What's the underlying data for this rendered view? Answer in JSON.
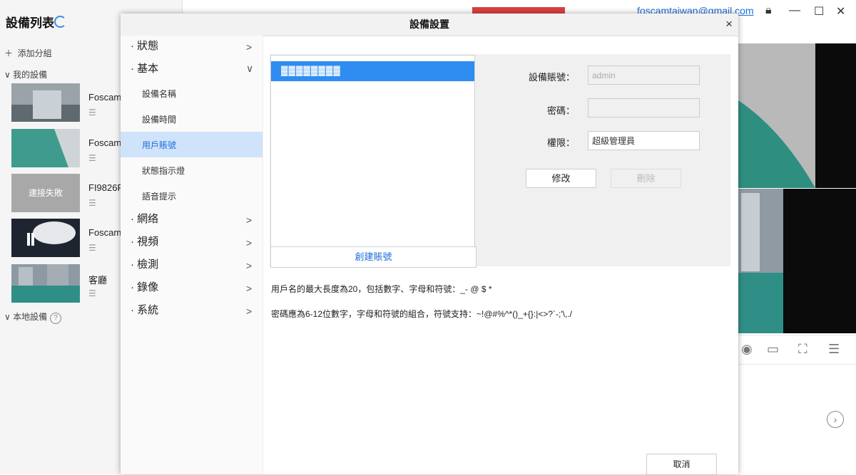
{
  "app": {
    "device_list_title": "設備列表",
    "add_group": "添加分組",
    "my_devices": "我的設備",
    "local_devices": "本地設備",
    "help_mark": "?",
    "email": "foscamtaiwan@gmail.com",
    "devices": [
      {
        "name": "Foscam_",
        "status": ""
      },
      {
        "name": "Foscam_",
        "status": ""
      },
      {
        "name": "FI9826P",
        "status": "連接失敗"
      },
      {
        "name": "Foscam_",
        "status": ""
      },
      {
        "name": "客廳",
        "status": ""
      }
    ]
  },
  "dialog": {
    "title": "設備設置",
    "close": "×",
    "menu": [
      {
        "label": "狀態",
        "expanded": false
      },
      {
        "label": "基本",
        "expanded": true
      },
      {
        "label": "網络",
        "expanded": false
      },
      {
        "label": "視頻",
        "expanded": false
      },
      {
        "label": "檢測",
        "expanded": false
      },
      {
        "label": "錄像",
        "expanded": false
      },
      {
        "label": "系統",
        "expanded": false
      }
    ],
    "submenu": [
      "設備名稱",
      "設備時間",
      "用戶賬號",
      "狀態指示燈",
      "語音提示"
    ],
    "active_submenu": "用戶賬號",
    "account_list": {
      "selected_row": "▓▓▓▓▓▓▓▓"
    },
    "create_account": "創建賬號",
    "form": {
      "account_label": "設備賬號：",
      "account_value": "admin",
      "password_label": "密碼：",
      "password_value": "",
      "permission_label": "權限：",
      "permission_value": "超級管理員",
      "modify": "修改",
      "delete": "刪除"
    },
    "notes": [
      "用戶名的最大長度為20，包括數字、字母和符號：_- @ $ *",
      "密碼應為6-12位數字，字母和符號的組合，符號支持：~!@#%^*()_+{}:|<>?`-;'\\,./"
    ],
    "cancel": "取消"
  },
  "colors": {
    "accent": "#1e6fd9",
    "selected_row": "#2f8cf0",
    "active_menu": "#cfe3fb"
  }
}
